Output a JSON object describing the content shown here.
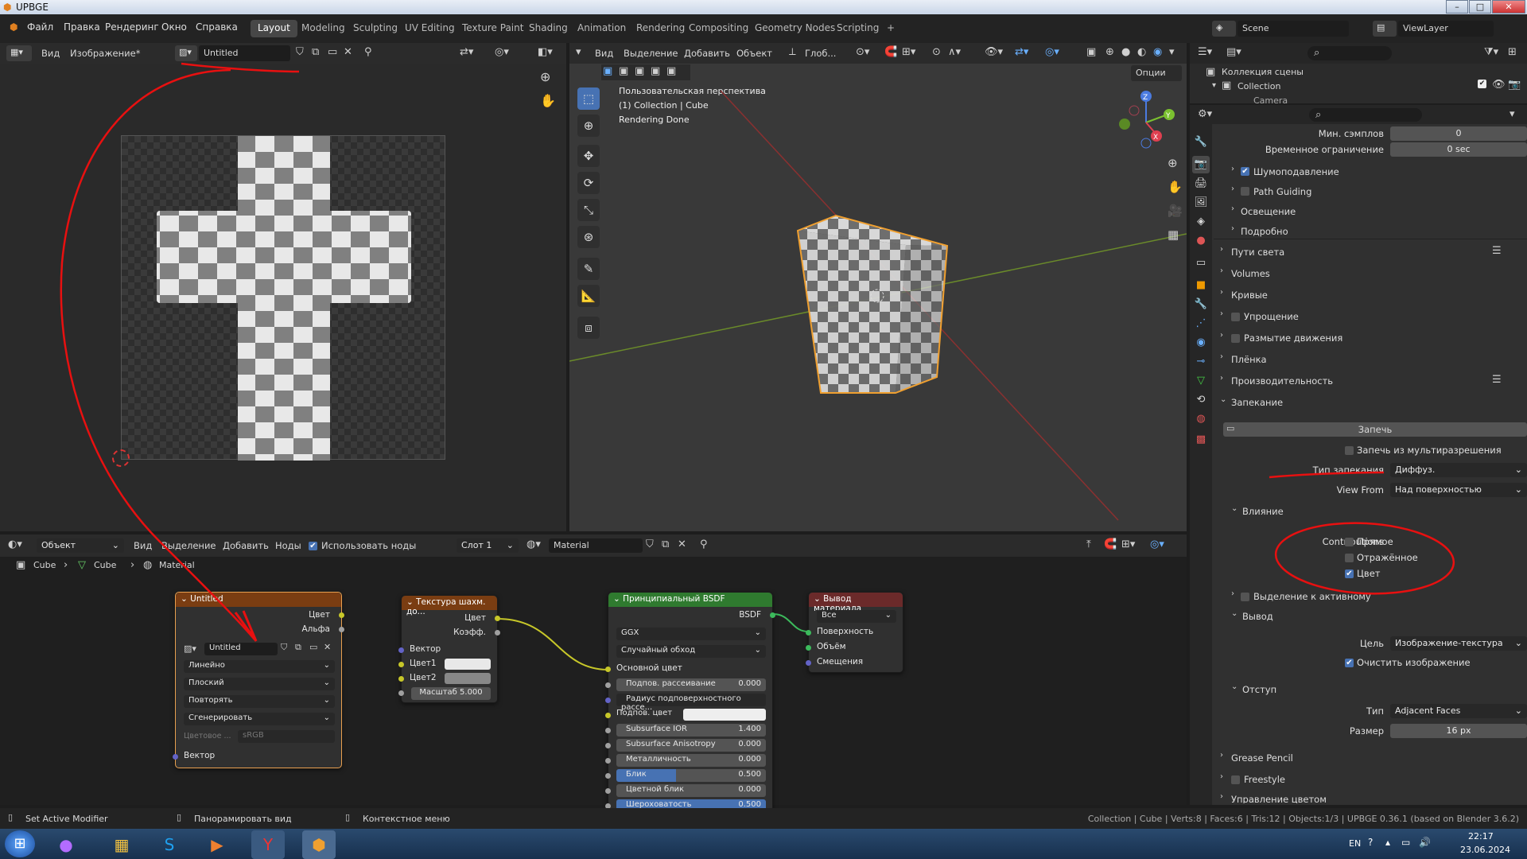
{
  "window": {
    "title": "UPBGE",
    "controls": [
      "–",
      "□",
      "✕"
    ]
  },
  "menu": {
    "items": [
      "Файл",
      "Правка",
      "Рендеринг",
      "Окно",
      "Справка"
    ]
  },
  "workspaces": [
    "Layout",
    "Modeling",
    "Sculpting",
    "UV Editing",
    "Texture Paint",
    "Shading",
    "Animation",
    "Rendering",
    "Compositing",
    "Geometry Nodes",
    "Scripting"
  ],
  "workspace_add": "+",
  "scene": {
    "label": "Scene",
    "viewlayer": "ViewLayer"
  },
  "image_editor": {
    "menus": [
      "Вид",
      "Изображение*"
    ],
    "image_name": "Untitled"
  },
  "viewport": {
    "menus": [
      "Вид",
      "Выделение",
      "Добавить",
      "Объект"
    ],
    "orientation": "Глоб...",
    "options": "Опции",
    "info_line1": "Пользовательская перспектива",
    "info_line2": "(1) Collection | Cube",
    "info_line3": "Rendering Done"
  },
  "outliner": {
    "scene_collection": "Коллекция сцены",
    "collection": "Collection",
    "camera": "Camera"
  },
  "properties": {
    "min_samples_label": "Мин. сэмплов",
    "min_samples_value": "0",
    "time_limit_label": "Временное ограничение",
    "time_limit_value": "0 sec",
    "sections": {
      "denoise": "Шумоподавление",
      "path_guiding": "Path Guiding",
      "lighting": "Освещение",
      "advanced": "Подробно",
      "light_paths": "Пути света",
      "volumes": "Volumes",
      "curves": "Кривые",
      "simplify": "Упрощение",
      "motion_blur": "Размытие движения",
      "film": "Плёнка",
      "performance": "Производительность",
      "bake": "Запекание",
      "influence": "Влияние",
      "selected_to_active": "Выделение к активному",
      "output": "Вывод",
      "margin": "Отступ",
      "grease_pencil": "Grease Pencil",
      "freestyle": "Freestyle",
      "color_management": "Управление цветом"
    },
    "bake_button": "Запечь",
    "bake_from_multires": "Запечь из мультиразрешения",
    "bake_type_label": "Тип запекания",
    "bake_type_value": "Диффуз.",
    "view_from_label": "View From",
    "view_from_value": "Над поверхностью",
    "contributions_label": "Contributions",
    "contrib_direct": "Прямое",
    "contrib_indirect": "Отражённое",
    "contrib_color": "Цвет",
    "target_label": "Цель",
    "target_value": "Изображение-текстура",
    "clear_image": "Очистить изображение",
    "margin_type_label": "Тип",
    "margin_type_value": "Adjacent Faces",
    "margin_size_label": "Размер",
    "margin_size_value": "16 px"
  },
  "node_editor": {
    "mode": "Объект",
    "menus": [
      "Вид",
      "Выделение",
      "Добавить",
      "Ноды"
    ],
    "use_nodes": "Использовать ноды",
    "slot": "Слот 1",
    "material": "Material",
    "breadcrumb": [
      "Cube",
      "Cube",
      "Material"
    ],
    "image_node": {
      "title": "Untitled",
      "out_color": "Цвет",
      "out_alpha": "Альфа",
      "image": "Untitled",
      "interp": "Линейно",
      "proj": "Плоский",
      "ext": "Повторять",
      "source": "Сгенерировать",
      "colorspace_label": "Цветовое ...",
      "colorspace": "sRGB",
      "vector": "Вектор"
    },
    "checker_node": {
      "title": "Текстура шахм. до...",
      "out_color": "Цвет",
      "out_fac": "Коэфф.",
      "vector": "Вектор",
      "color1": "Цвет1",
      "color2": "Цвет2",
      "scale": "Масштаб",
      "scale_value": "5.000"
    },
    "bsdf_node": {
      "title": "Принципиальный BSDF",
      "out": "BSDF",
      "dist": "GGX",
      "sss": "Случайный обход",
      "base_color": "Основной цвет",
      "rows": [
        [
          "Подпов. рассеивание",
          "0.000"
        ],
        [
          "Радиус подповерхностного рассе...",
          ""
        ],
        [
          "Подпов. цвет",
          ""
        ],
        [
          "Subsurface IOR",
          "1.400"
        ],
        [
          "Subsurface Anisotropy",
          "0.000"
        ],
        [
          "Металличность",
          "0.000"
        ],
        [
          "Блик",
          "0.500"
        ],
        [
          "Цветной блик",
          "0.000"
        ],
        [
          "Шероховатость",
          "0.500"
        ]
      ]
    },
    "output_node": {
      "title": "Вывод материала",
      "target": "Все",
      "surface": "Поверхность",
      "volume": "Объём",
      "disp": "Смещения"
    }
  },
  "statusbar": {
    "left1": "Set Active Modifier",
    "left2": "Панорамировать вид",
    "left3": "Контекстное меню",
    "right": "Collection | Cube | Verts:8 | Faces:6 | Tris:12 | Objects:1/3 | UPBGE 0.36.1 (based on Blender 3.6.2)"
  },
  "taskbar": {
    "lang": "EN",
    "time": "22:17",
    "date": "23.06.2024"
  },
  "colors": {
    "accent": "#4772b3",
    "annotation": "#e81010",
    "orange_select": "#f0a030",
    "node_texture": "#7a3d12",
    "node_shader": "#2f7a2f",
    "node_output": "#6b2a2a"
  }
}
